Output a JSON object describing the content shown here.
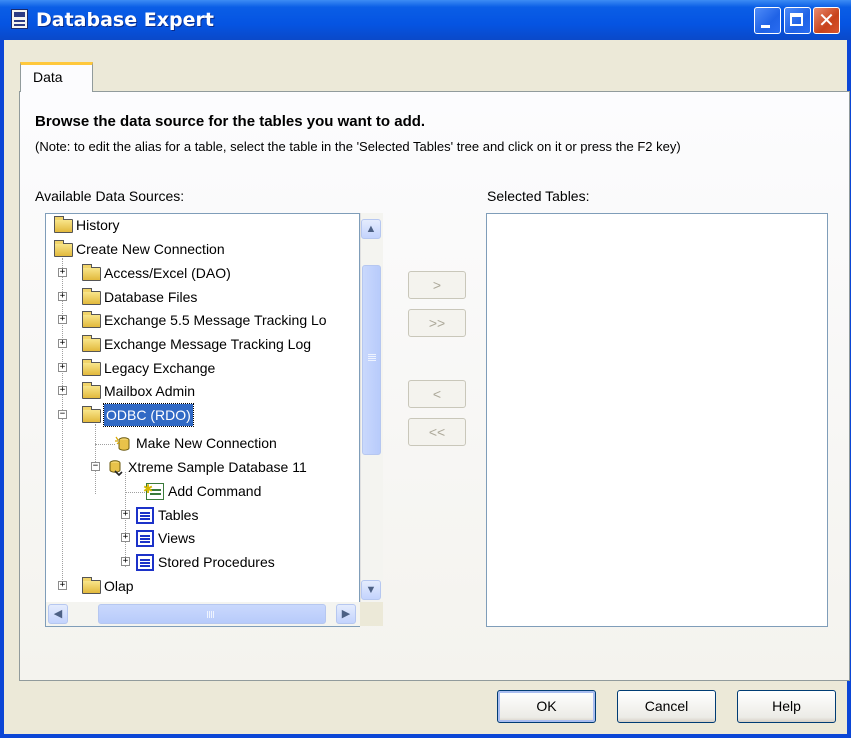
{
  "window": {
    "title": "Database Expert"
  },
  "tabs": [
    {
      "label": "Data",
      "selected": true
    }
  ],
  "instructions": {
    "heading": "Browse the data source for the tables you want to add.",
    "note": "(Note: to edit the alias for a table, select the table in the 'Selected Tables' tree and click on it or press the F2 key)"
  },
  "available": {
    "label": "Available Data Sources:",
    "tree": [
      {
        "label": "History",
        "icon": "folder-icon",
        "expander": "none"
      },
      {
        "label": "Create New Connection",
        "icon": "folder-icon",
        "expander": "none"
      },
      {
        "label": "Access/Excel (DAO)",
        "icon": "folder-icon",
        "expander": "+"
      },
      {
        "label": "Database Files",
        "icon": "folder-icon",
        "expander": "+"
      },
      {
        "label": "Exchange 5.5 Message Tracking Lo",
        "icon": "folder-icon",
        "expander": "+"
      },
      {
        "label": "Exchange Message Tracking Log",
        "icon": "folder-icon",
        "expander": "+"
      },
      {
        "label": "Legacy Exchange",
        "icon": "folder-icon",
        "expander": "+"
      },
      {
        "label": "Mailbox Admin",
        "icon": "folder-icon",
        "expander": "+"
      },
      {
        "label": "ODBC (RDO)",
        "icon": "folder-icon",
        "expander": "-",
        "selected": true
      },
      {
        "label": "Make New Connection",
        "icon": "new-connection-icon",
        "expander": "none"
      },
      {
        "label": "Xtreme Sample Database 11",
        "icon": "database-connection-icon",
        "expander": "-"
      },
      {
        "label": "Add Command",
        "icon": "add-command-icon",
        "expander": "none"
      },
      {
        "label": "Tables",
        "icon": "table-icon",
        "expander": "+"
      },
      {
        "label": "Views",
        "icon": "table-icon",
        "expander": "+"
      },
      {
        "label": "Stored Procedures",
        "icon": "table-icon",
        "expander": "+"
      },
      {
        "label": "Olap",
        "icon": "folder-icon",
        "expander": "+"
      }
    ]
  },
  "selected": {
    "label": "Selected Tables:",
    "items": []
  },
  "move_buttons": {
    "add": ">",
    "add_all": ">>",
    "remove": "<",
    "remove_all": "<<"
  },
  "footer": {
    "ok": "OK",
    "cancel": "Cancel",
    "help": "Help"
  },
  "colors": {
    "titlebar": "#0554e2",
    "dialog_face": "#ece9d8",
    "selection": "#316ac5",
    "tab_highlight": "#ffc83c"
  }
}
